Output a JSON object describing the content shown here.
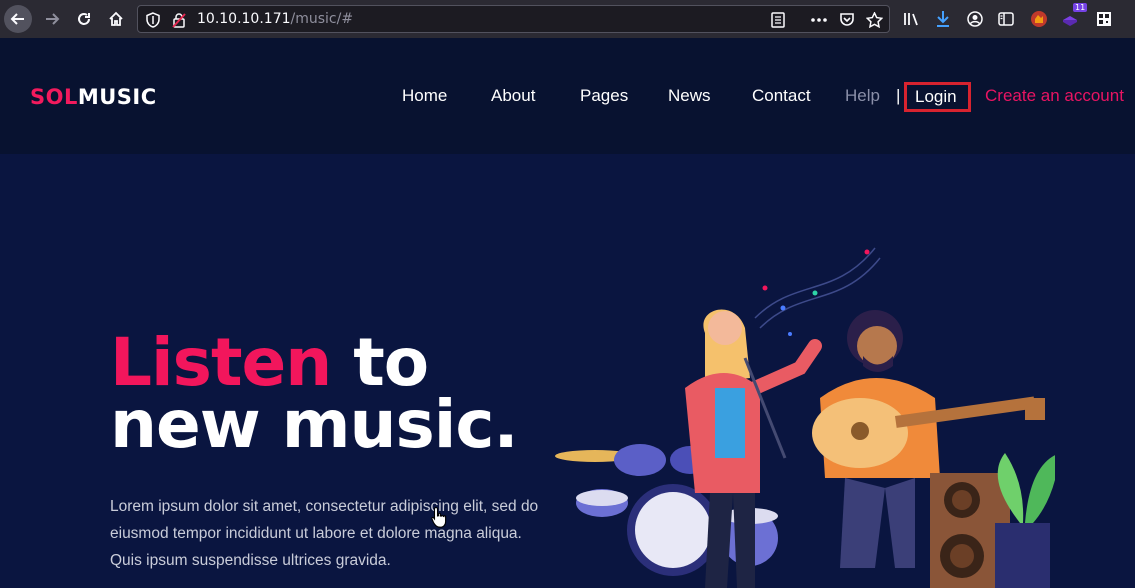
{
  "browser": {
    "url_host": "10.10.10.171",
    "url_path": "/music/#",
    "badge_count": "11",
    "icons": [
      "back-icon",
      "forward-icon",
      "reload-icon",
      "home-icon",
      "shield-icon",
      "insecure-lock-icon",
      "reader-view-icon",
      "more-icon",
      "pocket-icon",
      "bookmark-star-icon",
      "library-icon",
      "download-icon",
      "account-icon",
      "sidebar-icon",
      "extension-icon",
      "extension-badge-icon",
      "qr-icon"
    ]
  },
  "site": {
    "logo_sol": "SOL",
    "logo_music": "MUSIC",
    "nav": {
      "home": "Home",
      "about": "About",
      "pages": "Pages",
      "news": "News",
      "contact": "Contact",
      "help": "Help",
      "separator": "|",
      "login": "Login",
      "create_account": "Create an account"
    },
    "colors": {
      "accent": "#f2165c",
      "header_bg": "#081230",
      "hero_bg": "#0a1540",
      "login_highlight": "#d7232f"
    }
  },
  "hero": {
    "title_pink": "Listen",
    "title_rest_1": " to",
    "title_line_2": "new music.",
    "paragraph": "Lorem ipsum dolor sit amet, consectetur adipiscing elit, sed do eiusmod tempor incididunt ut labore et dolore magna aliqua. Quis ipsum suspendisse ultrices gravida."
  }
}
